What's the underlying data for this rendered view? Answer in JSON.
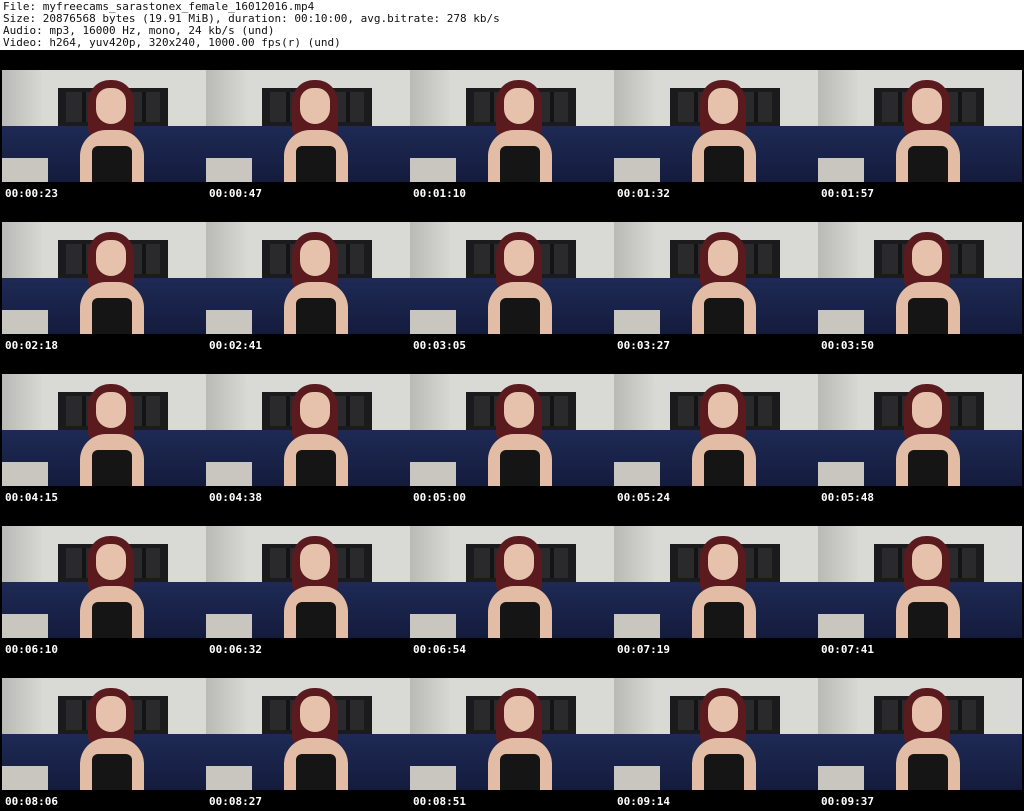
{
  "header": {
    "file_line": "File: myfreecams_sarastonex_female_16012016.mp4",
    "size_line": "Size: 20876568 bytes (19.91 MiB), duration: 00:10:00, avg.bitrate: 278 kb/s",
    "audio_line": "Audio: mp3, 16000 Hz, mono, 24 kb/s (und)",
    "video_line": "Video: h264, yuv420p, 320x240, 1000.00 fps(r) (und)"
  },
  "thumbnails": [
    {
      "time": "00:00:23"
    },
    {
      "time": "00:00:47"
    },
    {
      "time": "00:01:10"
    },
    {
      "time": "00:01:32"
    },
    {
      "time": "00:01:57"
    },
    {
      "time": "00:02:18"
    },
    {
      "time": "00:02:41"
    },
    {
      "time": "00:03:05"
    },
    {
      "time": "00:03:27"
    },
    {
      "time": "00:03:50"
    },
    {
      "time": "00:04:15"
    },
    {
      "time": "00:04:38"
    },
    {
      "time": "00:05:00"
    },
    {
      "time": "00:05:24"
    },
    {
      "time": "00:05:48"
    },
    {
      "time": "00:06:10"
    },
    {
      "time": "00:06:32"
    },
    {
      "time": "00:06:54"
    },
    {
      "time": "00:07:19"
    },
    {
      "time": "00:07:41"
    },
    {
      "time": "00:08:06"
    },
    {
      "time": "00:08:27"
    },
    {
      "time": "00:08:51"
    },
    {
      "time": "00:09:14"
    },
    {
      "time": "00:09:37"
    }
  ]
}
